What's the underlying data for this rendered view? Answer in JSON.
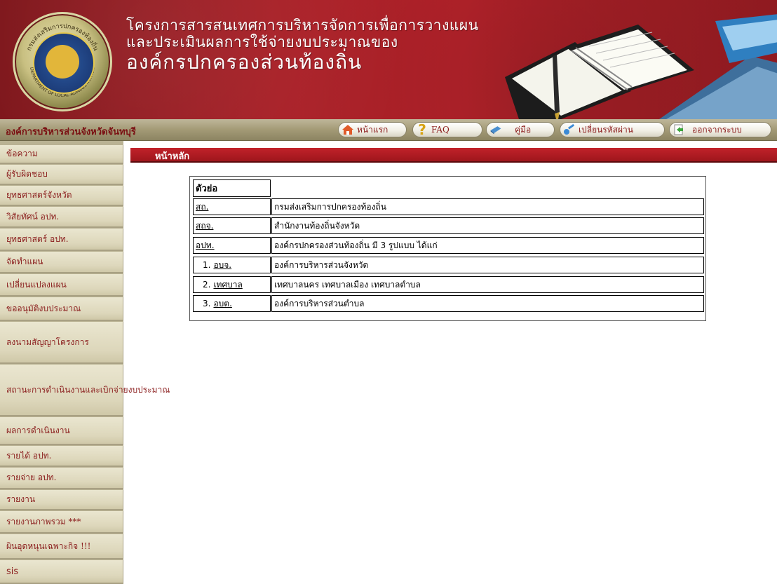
{
  "banner": {
    "title_line1": "โครงการสารสนเทศการบริหารจัดการเพื่อการวางแผน",
    "title_line2": "และประเมินผลการใช้จ่ายงบประมาณของ",
    "title_line3": "องค์กรปกครองส่วนท้องถิ่น",
    "logo_text_top": "กรมส่งเสริมการปกครองท้องถิ่น",
    "logo_text_bottom": "DEPARTMENT OF LOCAL ADMINISTRATION"
  },
  "navbar": {
    "org_name": "องค์การบริหารส่วนจังหวัดจันทบุรี",
    "buttons": [
      {
        "label": "หน้าแรก",
        "icon": "home-icon"
      },
      {
        "label": "FAQ",
        "icon": "question-icon"
      },
      {
        "label": "คู่มือ",
        "icon": "book-icon"
      },
      {
        "label": "เปลี่ยนรหัสผ่าน",
        "icon": "key-icon"
      },
      {
        "label": "ออกจากระบบ",
        "icon": "logout-icon"
      }
    ]
  },
  "sidebar": {
    "items": [
      "ข้อความ",
      "ผู้รับผิดชอบ",
      "ยุทธศาสตร์จังหวัด",
      "วิสัยทัศน์ อปท.",
      "ยุทธศาสตร์ อปท.",
      "จัดทำแผน",
      "เปลี่ยนแปลงแผน",
      "ขออนุมัติงบประมาณ",
      "ลงนามสัญญาโครงการ",
      "สถานะการดำเนินงานและเบิกจ่ายงบประมาณ",
      "ผลการดำเนินงาน",
      "รายได้ อปท.",
      "รายจ่าย อปท.",
      "รายงาน",
      "รายงานภาพรวม ***",
      "ผินอุดหนุนเฉพาะกิจ !!!",
      "sis"
    ]
  },
  "main": {
    "header": "หน้าหลัก",
    "table_header": "ตัวย่อ",
    "rows": [
      {
        "num": "",
        "abbr": "สถ.",
        "desc": "กรมส่งเสริมการปกครองท้องถิ่น"
      },
      {
        "num": "",
        "abbr": "สถจ.",
        "desc": "สำนักงานท้องถิ่นจังหวัด"
      },
      {
        "num": "",
        "abbr": "อปท.",
        "desc": "องค์กรปกครองส่วนท้องถิ่น มี 3 รูปแบบ ได้แก่"
      },
      {
        "num": "1.",
        "abbr": "อบจ.",
        "desc": "องค์การบริหารส่วนจังหวัด"
      },
      {
        "num": "2.",
        "abbr": "เทศบาล",
        "desc": "เทศบาลนคร เทศบาลเมือง เทศบาลตำบล"
      },
      {
        "num": "3.",
        "abbr": "อบต.",
        "desc": "องค์การบริหารส่วนตำบล"
      }
    ]
  },
  "colors": {
    "banner_red": "#a71f26",
    "nav_text": "#8a1818",
    "sidebar_text": "#8a1c1c",
    "header_red": "#c1222a"
  }
}
